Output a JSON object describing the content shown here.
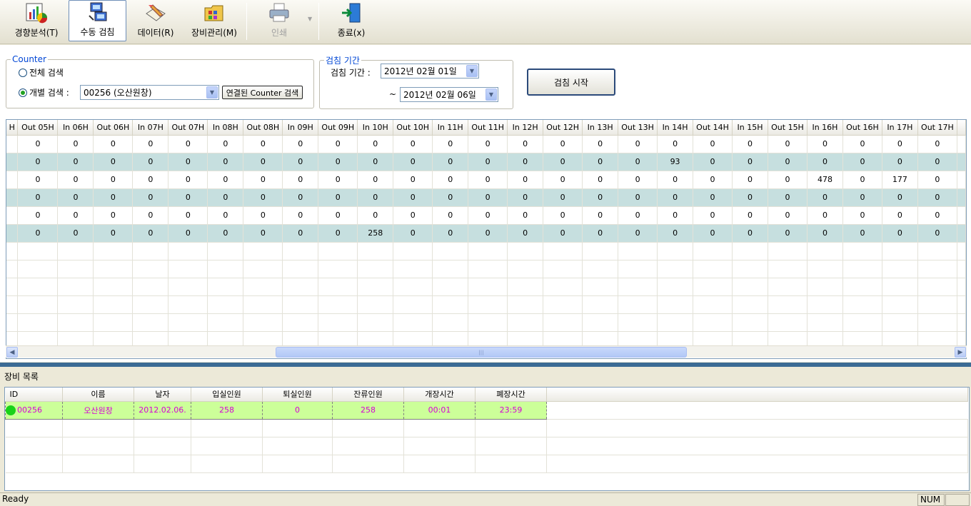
{
  "toolbar": {
    "buttons": [
      {
        "label": "경향분석(T)",
        "icon": "trend-analysis-icon"
      },
      {
        "label": "수동 검침",
        "icon": "manual-read-icon"
      },
      {
        "label": "데이터(R)",
        "icon": "data-icon"
      },
      {
        "label": "장비관리(M)",
        "icon": "equipment-manage-icon"
      },
      {
        "label": "인쇄",
        "icon": "printer-icon"
      },
      {
        "label": "종료(x)",
        "icon": "exit-icon"
      }
    ]
  },
  "counter": {
    "legend": "Counter",
    "all_label": "전체 검색",
    "individual_label": "개별 검색 :",
    "device_value": "00256 (오산원창)",
    "linked_button": "연결된 Counter 검색"
  },
  "period": {
    "legend": "검침 기간",
    "label": "검침 기간 :",
    "from": "2012년 02월 01일",
    "tilde": "~",
    "to": "2012년 02월 06일"
  },
  "start_button": "검침 시작",
  "grid": {
    "columns": [
      "H",
      "Out 05H",
      "In 06H",
      "Out 06H",
      "In 07H",
      "Out 07H",
      "In 08H",
      "Out 08H",
      "In 09H",
      "Out 09H",
      "In 10H",
      "Out 10H",
      "In 11H",
      "Out 11H",
      "In 12H",
      "Out 12H",
      "In 13H",
      "Out 13H",
      "In 14H",
      "Out 14H",
      "In 15H",
      "Out 15H",
      "In 16H",
      "Out 16H",
      "In 17H",
      "Out 17H",
      ""
    ],
    "rows": [
      [
        "",
        "0",
        "0",
        "0",
        "0",
        "0",
        "0",
        "0",
        "0",
        "0",
        "0",
        "0",
        "0",
        "0",
        "0",
        "0",
        "0",
        "0",
        "0",
        "0",
        "0",
        "0",
        "0",
        "0",
        "0",
        "0",
        ""
      ],
      [
        "",
        "0",
        "0",
        "0",
        "0",
        "0",
        "0",
        "0",
        "0",
        "0",
        "0",
        "0",
        "0",
        "0",
        "0",
        "0",
        "0",
        "0",
        "93",
        "0",
        "0",
        "0",
        "0",
        "0",
        "0",
        "0",
        ""
      ],
      [
        "",
        "0",
        "0",
        "0",
        "0",
        "0",
        "0",
        "0",
        "0",
        "0",
        "0",
        "0",
        "0",
        "0",
        "0",
        "0",
        "0",
        "0",
        "0",
        "0",
        "0",
        "0",
        "478",
        "0",
        "177",
        "0",
        ""
      ],
      [
        "",
        "0",
        "0",
        "0",
        "0",
        "0",
        "0",
        "0",
        "0",
        "0",
        "0",
        "0",
        "0",
        "0",
        "0",
        "0",
        "0",
        "0",
        "0",
        "0",
        "0",
        "0",
        "0",
        "0",
        "0",
        "0",
        ""
      ],
      [
        "",
        "0",
        "0",
        "0",
        "0",
        "0",
        "0",
        "0",
        "0",
        "0",
        "0",
        "0",
        "0",
        "0",
        "0",
        "0",
        "0",
        "0",
        "0",
        "0",
        "0",
        "0",
        "0",
        "0",
        "0",
        "0",
        ""
      ],
      [
        "",
        "0",
        "0",
        "0",
        "0",
        "0",
        "0",
        "0",
        "0",
        "0",
        "258",
        "0",
        "0",
        "0",
        "0",
        "0",
        "0",
        "0",
        "0",
        "0",
        "0",
        "0",
        "0",
        "0",
        "0",
        "0",
        ""
      ]
    ]
  },
  "equipment": {
    "title": "장비 목록",
    "columns": [
      "ID",
      "이름",
      "날자",
      "입실인원",
      "퇴실인원",
      "잔류인원",
      "개장시간",
      "폐장시간"
    ],
    "rows": [
      [
        "00256",
        "오산원창",
        "2012.02.06.",
        "258",
        "0",
        "258",
        "00:01",
        "23:59"
      ]
    ]
  },
  "status": {
    "text": "Ready",
    "num": "NUM"
  }
}
